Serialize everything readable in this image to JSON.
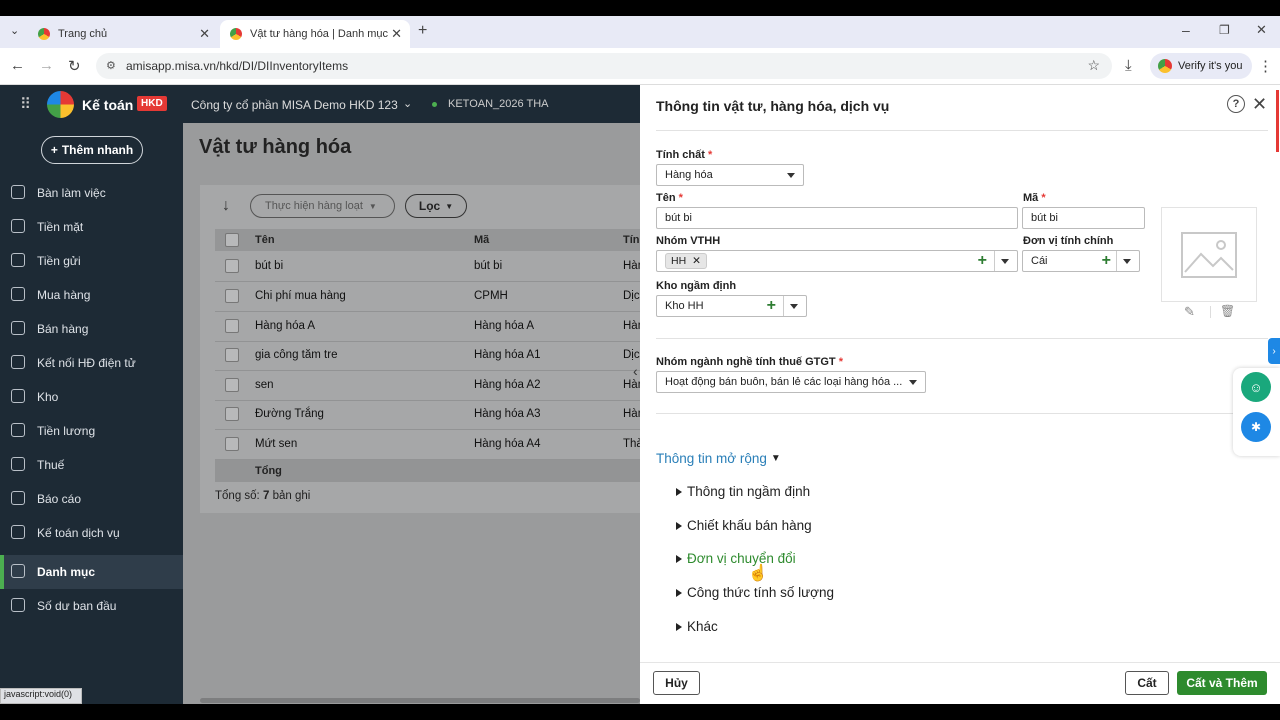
{
  "browser": {
    "tabs": [
      {
        "title": "Trang chủ"
      },
      {
        "title": "Vật tư hàng hóa | Danh mục | V"
      }
    ],
    "url": "amisapp.misa.vn/hkd/DI/DIInventoryItems",
    "verify_label": "Verify it's you",
    "status_text": "javascript:void(0)"
  },
  "app": {
    "brand": "Kế toán",
    "brand_badge": "HKD",
    "company": "Công ty cổ phần MISA Demo HKD 123",
    "dataset": "KETOAN_2026 THA",
    "quick_add": "Thêm nhanh",
    "colors": {
      "sidebar": "#1d2a35",
      "accent": "#4caf50",
      "primary_button": "#2e8b2e",
      "link": "#2a7fb8"
    }
  },
  "sidebar": {
    "items": [
      {
        "label": "Bàn làm việc",
        "icon": "dashboard-icon"
      },
      {
        "label": "Tiền mặt",
        "icon": "cash-icon"
      },
      {
        "label": "Tiền gửi",
        "icon": "bank-icon"
      },
      {
        "label": "Mua hàng",
        "icon": "bag-icon"
      },
      {
        "label": "Bán hàng",
        "icon": "cart-icon"
      },
      {
        "label": "Kết nối HĐ điện tử",
        "icon": "invoice-icon"
      },
      {
        "label": "Kho",
        "icon": "warehouse-icon"
      },
      {
        "label": "Tiền lương",
        "icon": "salary-icon"
      },
      {
        "label": "Thuế",
        "icon": "tax-icon"
      },
      {
        "label": "Báo cáo",
        "icon": "report-icon"
      },
      {
        "label": "Kế toán dịch vụ",
        "icon": "service-icon"
      },
      {
        "label": "Danh mục",
        "icon": "list-icon",
        "active": true
      },
      {
        "label": "Số dư ban đầu",
        "icon": "balance-icon"
      }
    ]
  },
  "list": {
    "title": "Vật tư hàng hóa",
    "batch_action": "Thực hiện hàng loạt",
    "filter": "Lọc",
    "columns": [
      "Tên",
      "Mã",
      "Tính"
    ],
    "rows": [
      {
        "name": "bút bi",
        "code": "bút bi",
        "type": "Hàn"
      },
      {
        "name": "Chi phí mua hàng",
        "code": "CPMH",
        "type": "Dịc"
      },
      {
        "name": "Hàng hóa A",
        "code": "Hàng hóa A",
        "type": "Hàn"
      },
      {
        "name": "gia công tăm tre",
        "code": "Hàng hóa A1",
        "type": "Dịc"
      },
      {
        "name": "sen",
        "code": "Hàng hóa A2",
        "type": "Hàn"
      },
      {
        "name": "Đường Trắng",
        "code": "Hàng hóa A3",
        "type": "Hàn"
      },
      {
        "name": "Mứt sen",
        "code": "Hàng hóa A4",
        "type": "Thà"
      }
    ],
    "total_label": "Tổng",
    "count_prefix": "Tổng số:",
    "count_value": "7",
    "count_suffix": "bản ghi"
  },
  "panel": {
    "title": "Thông tin vật tư, hàng hóa, dịch vụ",
    "nature_label": "Tính chất",
    "nature_value": "Hàng hóa",
    "name_label": "Tên",
    "name_value": "bút bi",
    "code_label": "Mã",
    "code_value": "bút bi",
    "group_label": "Nhóm VTHH",
    "group_tag": "HH",
    "unit_label": "Đơn vị tính chính",
    "unit_value": "Cái",
    "warehouse_label": "Kho ngầm định",
    "warehouse_value": "Kho HH",
    "tax_group_label": "Nhóm ngành nghề tính thuế GTGT",
    "tax_group_value": "Hoạt động bán buôn, bán lẻ các loại hàng hóa ...",
    "extended_label": "Thông tin mở rộng",
    "sections": [
      "Thông tin ngầm định",
      "Chiết khấu bán hàng",
      "Đơn vị chuyển đổi",
      "Công thức tính số lượng",
      "Khác"
    ],
    "cancel": "Hủy",
    "save": "Cất",
    "save_add": "Cất và Thêm"
  }
}
